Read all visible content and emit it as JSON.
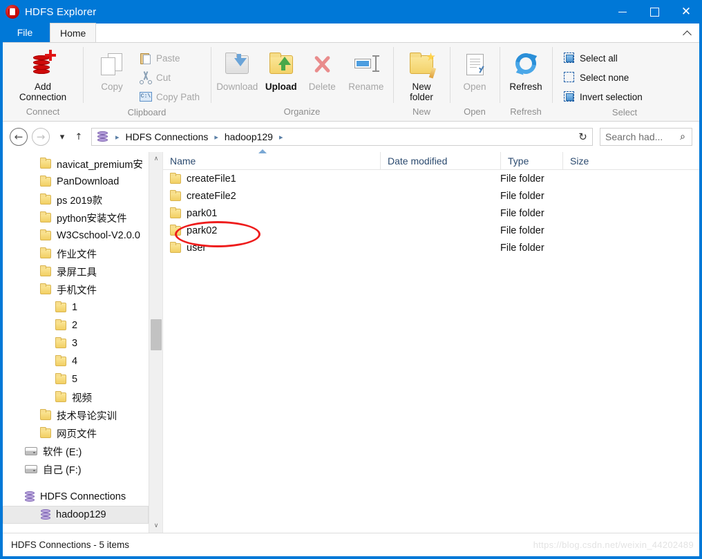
{
  "window": {
    "title": "HDFS Explorer",
    "icon": "hdfs-app-icon",
    "minimize": "—",
    "maximize": "□",
    "close": "✕"
  },
  "tabs": {
    "file": "File",
    "home": "Home",
    "collapse_ribbon": "collapse-ribbon-icon"
  },
  "ribbon": {
    "groups": [
      {
        "name": "connect",
        "label": "Connect",
        "buttons": [
          {
            "label": "Add\nConnection",
            "line1": "Add",
            "line2": "Connection",
            "icon": "database-plus-icon",
            "enabled": true
          }
        ]
      },
      {
        "name": "clipboard",
        "label": "Clipboard",
        "buttons": [
          {
            "label": "Copy",
            "icon": "copy-icon",
            "enabled": false
          },
          {
            "label": "Paste",
            "icon": "paste-icon",
            "enabled": false
          },
          {
            "label": "Cut",
            "icon": "scissors-icon",
            "enabled": false
          },
          {
            "label": "Copy Path",
            "icon": "copy-path-icon",
            "enabled": false
          }
        ]
      },
      {
        "name": "organize",
        "label": "Organize",
        "buttons": [
          {
            "label": "Download",
            "icon": "folder-download-icon",
            "enabled": false
          },
          {
            "label": "Upload",
            "icon": "folder-upload-icon",
            "enabled": true
          },
          {
            "label": "Delete",
            "icon": "delete-x-icon",
            "enabled": false
          },
          {
            "label": "Rename",
            "icon": "rename-icon",
            "enabled": false
          }
        ]
      },
      {
        "name": "new",
        "label": "New",
        "buttons": [
          {
            "label": "New folder",
            "line1": "New",
            "line2": "folder",
            "icon": "new-folder-icon",
            "enabled": true
          }
        ]
      },
      {
        "name": "open",
        "label": "Open",
        "buttons": [
          {
            "label": "Open",
            "icon": "open-document-icon",
            "enabled": false
          }
        ]
      },
      {
        "name": "refresh",
        "label": "Refresh",
        "buttons": [
          {
            "label": "Refresh",
            "icon": "refresh-icon",
            "enabled": true
          }
        ]
      },
      {
        "name": "select",
        "label": "Select",
        "buttons": [
          {
            "label": "Select all",
            "icon": "select-all-icon",
            "enabled": true
          },
          {
            "label": "Select none",
            "icon": "select-none-icon",
            "enabled": true
          },
          {
            "label": "Invert selection",
            "icon": "invert-selection-icon",
            "enabled": true
          }
        ]
      }
    ]
  },
  "navbar": {
    "back": "←",
    "forward": "→",
    "history": "▾",
    "up": "↑",
    "breadcrumb_icon": "database-icon",
    "breadcrumbs": [
      "HDFS Connections",
      "hadoop129"
    ],
    "separator": "▸",
    "refresh": "↻",
    "search_placeholder": "Search had...",
    "search_value": "",
    "search_icon": "⌕"
  },
  "tree": {
    "items": [
      {
        "label": "navicat_premium安",
        "icon": "folder-icon",
        "indent": 2,
        "selected": false
      },
      {
        "label": "PanDownload",
        "icon": "folder-icon",
        "indent": 2,
        "selected": false
      },
      {
        "label": "ps 2019款",
        "icon": "folder-icon",
        "indent": 2,
        "selected": false
      },
      {
        "label": "python安装文件",
        "icon": "folder-icon",
        "indent": 2,
        "selected": false
      },
      {
        "label": "W3Cschool-V2.0.0",
        "icon": "folder-icon",
        "indent": 2,
        "selected": false
      },
      {
        "label": "作业文件",
        "icon": "folder-icon",
        "indent": 2,
        "selected": false
      },
      {
        "label": "录屏工具",
        "icon": "folder-icon",
        "indent": 2,
        "selected": false
      },
      {
        "label": "手机文件",
        "icon": "folder-icon",
        "indent": 2,
        "selected": false
      },
      {
        "label": "1",
        "icon": "folder-icon",
        "indent": 3,
        "selected": false
      },
      {
        "label": "2",
        "icon": "folder-icon",
        "indent": 3,
        "selected": false
      },
      {
        "label": "3",
        "icon": "folder-icon",
        "indent": 3,
        "selected": false
      },
      {
        "label": "4",
        "icon": "folder-icon",
        "indent": 3,
        "selected": false
      },
      {
        "label": "5",
        "icon": "folder-icon",
        "indent": 3,
        "selected": false
      },
      {
        "label": "视频",
        "icon": "folder-icon",
        "indent": 3,
        "selected": false
      },
      {
        "label": "技术导论实训",
        "icon": "folder-icon",
        "indent": 2,
        "selected": false
      },
      {
        "label": "网页文件",
        "icon": "folder-icon",
        "indent": 2,
        "selected": false
      },
      {
        "label": "软件 (E:)",
        "icon": "drive-icon",
        "indent": 1,
        "selected": false
      },
      {
        "label": "自己 (F:)",
        "icon": "drive-icon",
        "indent": 1,
        "selected": false
      },
      {
        "label": "",
        "icon": "spacer",
        "indent": 0,
        "selected": false
      },
      {
        "label": "HDFS Connections",
        "icon": "database-icon",
        "indent": 1,
        "selected": false
      },
      {
        "label": "hadoop129",
        "icon": "database-icon",
        "indent": 2,
        "selected": true
      }
    ],
    "scrollbar": {
      "up": "∧",
      "down": "∨"
    }
  },
  "filelist": {
    "columns": [
      "Name",
      "Date modified",
      "Type",
      "Size"
    ],
    "sort": {
      "column": "Name",
      "direction": "asc"
    },
    "rows": [
      {
        "name": "createFile1",
        "date": "",
        "type": "File folder",
        "size": "",
        "icon": "folder-icon"
      },
      {
        "name": "createFile2",
        "date": "",
        "type": "File folder",
        "size": "",
        "icon": "folder-icon"
      },
      {
        "name": "park01",
        "date": "",
        "type": "File folder",
        "size": "",
        "icon": "folder-icon"
      },
      {
        "name": "park02",
        "date": "",
        "type": "File folder",
        "size": "",
        "icon": "folder-icon"
      },
      {
        "name": "user",
        "date": "",
        "type": "File folder",
        "size": "",
        "icon": "folder-icon"
      }
    ],
    "annotation": {
      "shape": "ellipse",
      "target": "park02",
      "color": "#ee1c1c"
    }
  },
  "statusbar": {
    "text": "HDFS Connections - 5 items",
    "watermark": "https://blog.csdn.net/weixin_44202489"
  },
  "colors": {
    "titlebar": "#0078d7",
    "accent": "#0078d7",
    "ribbon_bg": "#f6f6f6",
    "annotation": "#ee1c1c",
    "column_header_text": "#2b4a6f"
  }
}
